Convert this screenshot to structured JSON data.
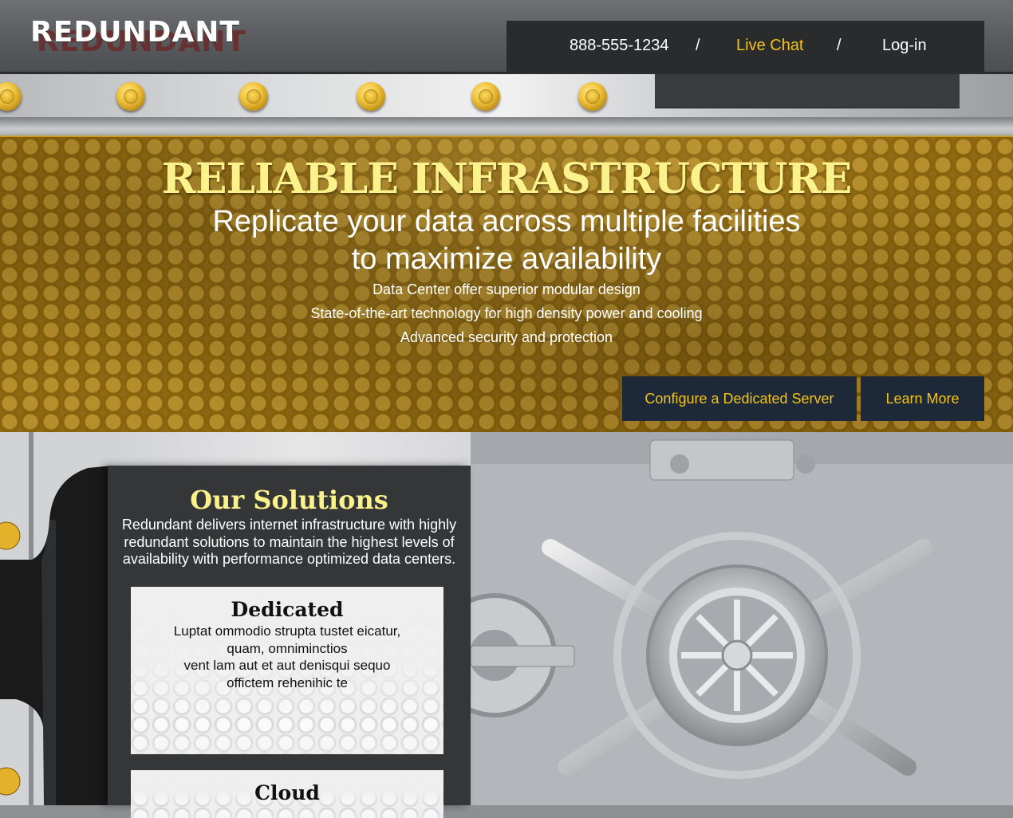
{
  "header": {
    "logo_text": "REDUNDANT",
    "phone": "888-555-1234",
    "separator": "/",
    "live_chat": "Live Chat",
    "login": "Log-in"
  },
  "hero": {
    "title": "RELIABLE INFRASTRUCTURE",
    "subtitle_line1": "Replicate your data across multiple facilities",
    "subtitle_line2": "to maximize availability",
    "features": [
      "Data Center offer superior modular design",
      "State-of-the-art technology for high density power and cooling",
      "Advanced security and protection"
    ],
    "buttons": {
      "configure": "Configure a Dedicated Server",
      "learn_more": "Learn More"
    }
  },
  "solutions": {
    "heading": "Our Solutions",
    "description": "Redundant delivers internet infrastructure with highly redundant solutions to maintain the highest levels of availability with performance optimized data centers.",
    "cards": [
      {
        "title": "Dedicated",
        "lines": [
          "Luptat ommodio strupta tustet eicatur,",
          "quam, omniminctios",
          "vent lam aut et aut denisqui sequo",
          "offictem rehenihic te"
        ]
      },
      {
        "title": "Cloud"
      }
    ]
  },
  "colors": {
    "accent_gold": "#f3c318",
    "title_yellow": "#fbf28c",
    "button_navy": "#1d2939",
    "hero_gold": "#8f6a12"
  },
  "icons": [
    "gold-bolt-icon",
    "vault-wheel-image"
  ]
}
